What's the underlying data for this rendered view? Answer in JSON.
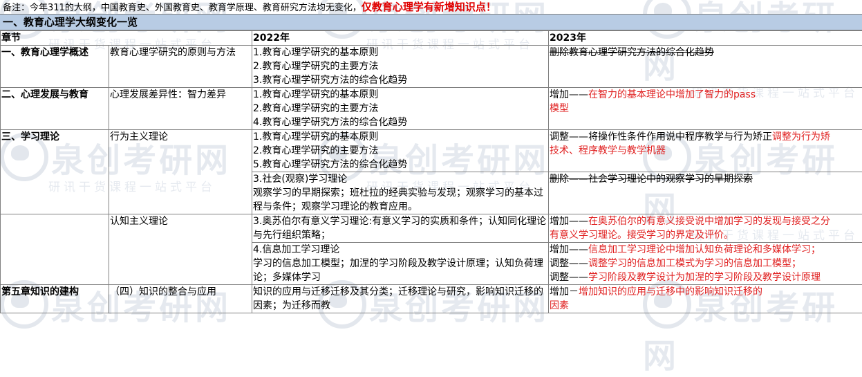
{
  "note": {
    "prefix": "备注：今年311的大纲，中国教育史、外国教育史、教育学原理、教育研究方法均无变化，",
    "highlight": "仅教育心理学有新增知识点！"
  },
  "section_title": "一、教育心理学大纲变化一览",
  "headers": {
    "chapter": "章节",
    "y2022": "2022年",
    "y2023": "2023年"
  },
  "rows": {
    "r1": {
      "chapter": "一、教育心理学概述",
      "topic": "教育心理学研究的原则与方法",
      "old": [
        "1.教育心理学研究的基本原则",
        "2.教育心理学研究的主要方法",
        "3.教育心理学研究方法的综合化趋势"
      ],
      "new": "删除教育心理学研究方法的综合化趋势"
    },
    "r2": {
      "chapter": "二、心理发展与教育",
      "topic": "心理发展差异性：智力差异",
      "old": [
        "1.教育心理学研究的基本原则",
        "2.教育心理学研究的主要方法",
        "4.教育心理学研究方法的综合化趋势"
      ],
      "new_prefix": "增加——",
      "new_red1": "在智力的基本理论中增加了智力的pass",
      "new_red2": "模型"
    },
    "r3": {
      "chapter": "三、学习理论",
      "topic": "行为主义理论",
      "old": [
        "1.教育心理学研究的基本原则",
        "2.教育心理学研究的主要方法",
        "5.教育心理学研究方法的综合化趋势"
      ],
      "new_prefix": "调整——将操作性条件作用说中程序教学与行为矫正",
      "new_red1": "调整为行为矫",
      "new_red2": "技术、程序教学与教学机器"
    },
    "r4": {
      "old_title": "3.社会(观察)学习理论",
      "old_body": "观察学习的早期探索；班杜拉的经典实验与发现；观察学习的基本过程与条件；观察学习理论的教育应用。",
      "new_a": "删除",
      "new_b": "——社会学习理论中的观察学习的早期探索"
    },
    "r5": {
      "topic": "认知主义理论",
      "old": "3.奥苏伯尔有意义学习理论:有意义学习的实质和条件；认知同化理论与先行组织策略；",
      "new_prefix": "增加——",
      "new_red1": "在奥苏伯尔的有意义接受说中增加学习的发现与接受之分",
      "new_red2": "有意义学习理论。接受学习的界定及评价。"
    },
    "r6": {
      "old_title": "4.信息加工学习理论",
      "old_body": "学习的信息加工模型；加涅的学习阶段及教学设计原理；认知负荷理论；多媒体学习",
      "new": [
        {
          "prefix": "增加——",
          "red": "信息加工学习理论中增加认知负荷理论和多媒体学习；"
        },
        {
          "prefix": "调整——",
          "red": "调整学习的信息加工模式为学习的信息加工模型；"
        },
        {
          "prefix": "调整——",
          "red": "学习阶段及教学设计为加涅的学习阶段及教学设计原理"
        }
      ]
    },
    "r7": {
      "chapter": "第五章知识的建构",
      "topic": "（四）知识的整合与应用",
      "old": "知识的应用与迁移迁移及其分类；迁移理论与研究，影响知识迁移的因素；为迁移而教",
      "new_prefix": "增加－",
      "new_red1": "增加知识的应用与迁移中的影响知识迁移的",
      "new_red2": "因素"
    }
  },
  "watermark": {
    "brand": "泉创考研网",
    "slogan": "研讯干货课程一站式平台"
  }
}
